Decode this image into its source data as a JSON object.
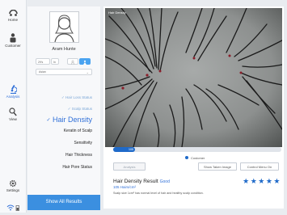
{
  "sidebar": {
    "items": [
      {
        "label": "Home",
        "icon": "home-icon"
      },
      {
        "label": "Customer",
        "icon": "customer-icon"
      },
      {
        "label": "Analysis",
        "icon": "analysis-icon",
        "active": true
      },
      {
        "label": "View",
        "icon": "view-icon"
      }
    ],
    "settings_label": "Settings",
    "status_icons": [
      "wifi-icon",
      "battery-icon"
    ]
  },
  "profile": {
    "name": "Aram Hunte",
    "age": "29's",
    "age_unit": "In",
    "gender_selected": "female",
    "select_value": "Asian",
    "menu": [
      {
        "label": "Hair Loss Status",
        "state": "done"
      },
      {
        "label": "Scalp Status",
        "state": "done"
      },
      {
        "label": "Hair Density",
        "state": "current"
      },
      {
        "label": "Keratin of Scalp",
        "state": "pending"
      },
      {
        "label": "Sensitivity",
        "state": "pending"
      },
      {
        "label": "Hair Thickness",
        "state": "pending"
      },
      {
        "label": "Hair Pore Status",
        "state": "pending"
      }
    ],
    "show_all_label": "Show All Results"
  },
  "main": {
    "image_title": "Hair Density",
    "progress": {
      "value": "105",
      "fraction": 0.13
    },
    "legend_label": "Customer",
    "buttons": {
      "analysis": "Analysis",
      "show_taken": "Show Taken Image",
      "control_menu": "Control Menu On"
    },
    "result": {
      "title": "Hair Density Result",
      "grade": "Good",
      "value": "105 Hairs/cm²",
      "description": "Scalp size 1cm² has normal level of hair and healthy scalp condition.",
      "stars": 5
    }
  },
  "colors": {
    "accent": "#2f6fd8",
    "button": "#3b8fe0",
    "progress": "#1f6ac9"
  }
}
